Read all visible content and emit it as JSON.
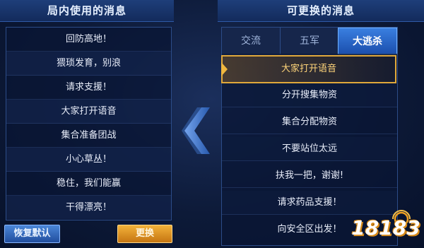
{
  "left_panel": {
    "title": "局内使用的消息",
    "messages": [
      "回防高地！",
      "猥琐发育，别浪",
      "请求支援！",
      "大家打开语音",
      "集合准备团战",
      "小心草丛！",
      "稳住，我们能赢",
      "干得漂亮！"
    ]
  },
  "right_panel": {
    "title": "可更换的消息",
    "tabs": [
      "交流",
      "五军",
      "大逃杀"
    ],
    "active_tab": "大逃杀",
    "selected_message": "大家打开语音",
    "messages": [
      "分开搜集物资",
      "集合分配物资",
      "不要站位太远",
      "扶我一把，谢谢!",
      "请求药品支援！",
      "向安全区出发！"
    ]
  },
  "buttons": {
    "reset_label": "恢复默认",
    "replace_label": "更换"
  },
  "watermark": {
    "text": "18183"
  },
  "colors": {
    "accent_gold": "#e0a83a",
    "tab_active": "#2f6fd0",
    "panel_border": "#2c4c88"
  },
  "icons": {
    "swap_arrow": "chevron-left-icon"
  }
}
